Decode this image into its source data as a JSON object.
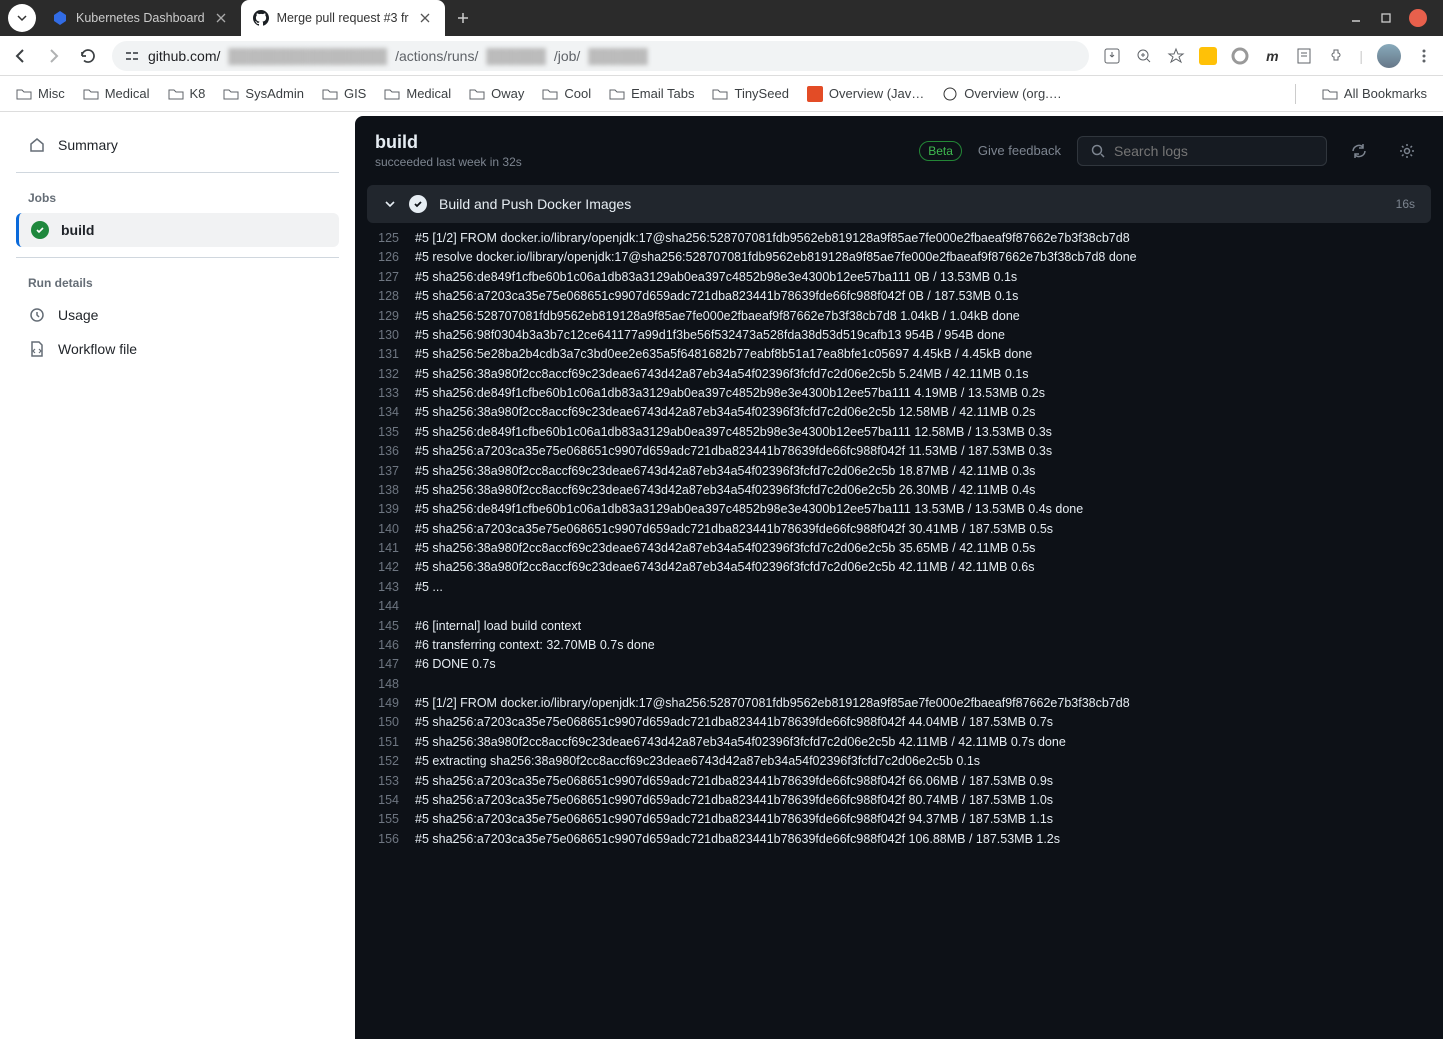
{
  "browser": {
    "tabs": [
      {
        "title": "Kubernetes Dashboard",
        "active": false
      },
      {
        "title": "Merge pull request #3 fr",
        "active": true
      }
    ],
    "url_prefix": "github.com/",
    "url_mid1": "/actions/runs/",
    "url_mid2": "/job/",
    "bookmarks": [
      "Misc",
      "Medical",
      "K8",
      "SysAdmin",
      "GIS",
      "Medical",
      "Oway",
      "Cool",
      "Email Tabs",
      "TinySeed"
    ],
    "bookmark_pills": [
      "Overview (Jav…",
      "Overview (org.…"
    ],
    "all_bookmarks": "All Bookmarks"
  },
  "sidebar": {
    "summary": "Summary",
    "jobs_label": "Jobs",
    "build": "build",
    "run_details_label": "Run details",
    "usage": "Usage",
    "workflow_file": "Workflow file"
  },
  "header": {
    "title": "build",
    "subtitle": "succeeded last week in 32s",
    "beta": "Beta",
    "feedback": "Give feedback",
    "search_placeholder": "Search logs"
  },
  "step": {
    "title": "Build and Push Docker Images",
    "time": "16s"
  },
  "logs": [
    {
      "n": "125",
      "t": "#5 [1/2] FROM docker.io/library/openjdk:17@sha256:528707081fdb9562eb819128a9f85ae7fe000e2fbaeaf9f87662e7b3f38cb7d8"
    },
    {
      "n": "126",
      "t": "#5 resolve docker.io/library/openjdk:17@sha256:528707081fdb9562eb819128a9f85ae7fe000e2fbaeaf9f87662e7b3f38cb7d8 done"
    },
    {
      "n": "127",
      "t": "#5 sha256:de849f1cfbe60b1c06a1db83a3129ab0ea397c4852b98e3e4300b12ee57ba111 0B / 13.53MB 0.1s"
    },
    {
      "n": "128",
      "t": "#5 sha256:a7203ca35e75e068651c9907d659adc721dba823441b78639fde66fc988f042f 0B / 187.53MB 0.1s"
    },
    {
      "n": "129",
      "t": "#5 sha256:528707081fdb9562eb819128a9f85ae7fe000e2fbaeaf9f87662e7b3f38cb7d8 1.04kB / 1.04kB done"
    },
    {
      "n": "130",
      "t": "#5 sha256:98f0304b3a3b7c12ce641177a99d1f3be56f532473a528fda38d53d519cafb13 954B / 954B done"
    },
    {
      "n": "131",
      "t": "#5 sha256:5e28ba2b4cdb3a7c3bd0ee2e635a5f6481682b77eabf8b51a17ea8bfe1c05697 4.45kB / 4.45kB done"
    },
    {
      "n": "132",
      "t": "#5 sha256:38a980f2cc8accf69c23deae6743d42a87eb34a54f02396f3fcfd7c2d06e2c5b 5.24MB / 42.11MB 0.1s"
    },
    {
      "n": "133",
      "t": "#5 sha256:de849f1cfbe60b1c06a1db83a3129ab0ea397c4852b98e3e4300b12ee57ba111 4.19MB / 13.53MB 0.2s"
    },
    {
      "n": "134",
      "t": "#5 sha256:38a980f2cc8accf69c23deae6743d42a87eb34a54f02396f3fcfd7c2d06e2c5b 12.58MB / 42.11MB 0.2s"
    },
    {
      "n": "135",
      "t": "#5 sha256:de849f1cfbe60b1c06a1db83a3129ab0ea397c4852b98e3e4300b12ee57ba111 12.58MB / 13.53MB 0.3s"
    },
    {
      "n": "136",
      "t": "#5 sha256:a7203ca35e75e068651c9907d659adc721dba823441b78639fde66fc988f042f 11.53MB / 187.53MB 0.3s"
    },
    {
      "n": "137",
      "t": "#5 sha256:38a980f2cc8accf69c23deae6743d42a87eb34a54f02396f3fcfd7c2d06e2c5b 18.87MB / 42.11MB 0.3s"
    },
    {
      "n": "138",
      "t": "#5 sha256:38a980f2cc8accf69c23deae6743d42a87eb34a54f02396f3fcfd7c2d06e2c5b 26.30MB / 42.11MB 0.4s"
    },
    {
      "n": "139",
      "t": "#5 sha256:de849f1cfbe60b1c06a1db83a3129ab0ea397c4852b98e3e4300b12ee57ba111 13.53MB / 13.53MB 0.4s done"
    },
    {
      "n": "140",
      "t": "#5 sha256:a7203ca35e75e068651c9907d659adc721dba823441b78639fde66fc988f042f 30.41MB / 187.53MB 0.5s"
    },
    {
      "n": "141",
      "t": "#5 sha256:38a980f2cc8accf69c23deae6743d42a87eb34a54f02396f3fcfd7c2d06e2c5b 35.65MB / 42.11MB 0.5s"
    },
    {
      "n": "142",
      "t": "#5 sha256:38a980f2cc8accf69c23deae6743d42a87eb34a54f02396f3fcfd7c2d06e2c5b 42.11MB / 42.11MB 0.6s"
    },
    {
      "n": "143",
      "t": "#5 ..."
    },
    {
      "n": "144",
      "t": ""
    },
    {
      "n": "145",
      "t": "#6 [internal] load build context"
    },
    {
      "n": "146",
      "t": "#6 transferring context: 32.70MB 0.7s done"
    },
    {
      "n": "147",
      "t": "#6 DONE 0.7s"
    },
    {
      "n": "148",
      "t": ""
    },
    {
      "n": "149",
      "t": "#5 [1/2] FROM docker.io/library/openjdk:17@sha256:528707081fdb9562eb819128a9f85ae7fe000e2fbaeaf9f87662e7b3f38cb7d8"
    },
    {
      "n": "150",
      "t": "#5 sha256:a7203ca35e75e068651c9907d659adc721dba823441b78639fde66fc988f042f 44.04MB / 187.53MB 0.7s"
    },
    {
      "n": "151",
      "t": "#5 sha256:38a980f2cc8accf69c23deae6743d42a87eb34a54f02396f3fcfd7c2d06e2c5b 42.11MB / 42.11MB 0.7s done"
    },
    {
      "n": "152",
      "t": "#5 extracting sha256:38a980f2cc8accf69c23deae6743d42a87eb34a54f02396f3fcfd7c2d06e2c5b 0.1s"
    },
    {
      "n": "153",
      "t": "#5 sha256:a7203ca35e75e068651c9907d659adc721dba823441b78639fde66fc988f042f 66.06MB / 187.53MB 0.9s"
    },
    {
      "n": "154",
      "t": "#5 sha256:a7203ca35e75e068651c9907d659adc721dba823441b78639fde66fc988f042f 80.74MB / 187.53MB 1.0s"
    },
    {
      "n": "155",
      "t": "#5 sha256:a7203ca35e75e068651c9907d659adc721dba823441b78639fde66fc988f042f 94.37MB / 187.53MB 1.1s"
    },
    {
      "n": "156",
      "t": "#5 sha256:a7203ca35e75e068651c9907d659adc721dba823441b78639fde66fc988f042f 106.88MB / 187.53MB 1.2s"
    }
  ]
}
